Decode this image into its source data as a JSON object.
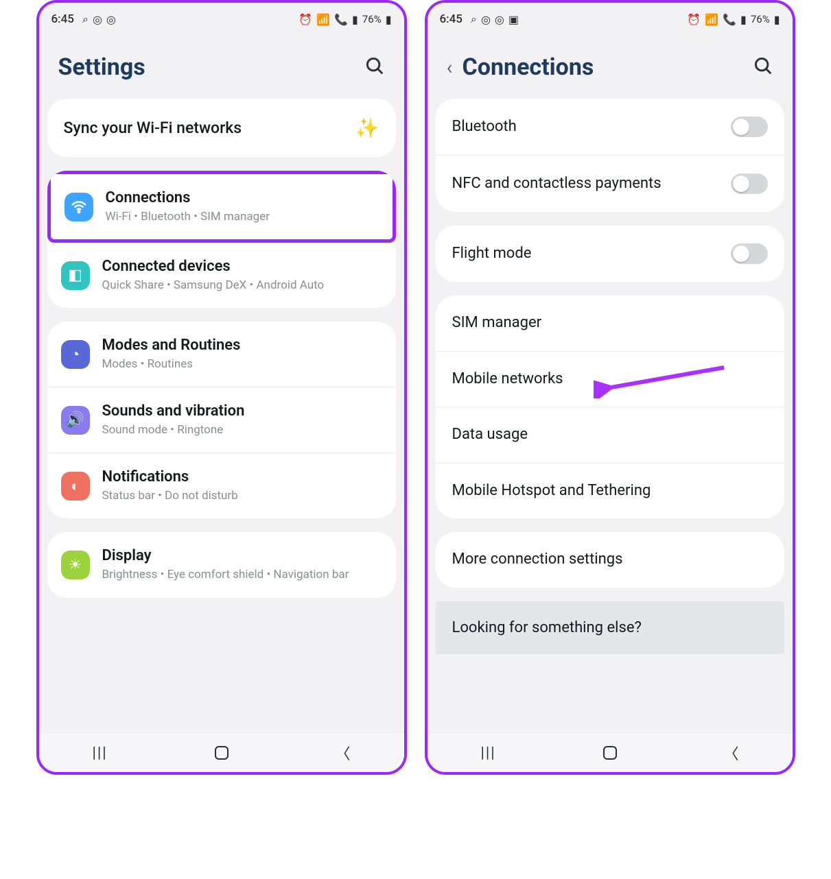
{
  "status": {
    "time": "6:45",
    "battery_pct": "76%"
  },
  "left": {
    "title": "Settings",
    "sync_label": "Sync your Wi-Fi networks",
    "items": [
      {
        "title": "Connections",
        "sub": "Wi-Fi  •  Bluetooth  •  SIM manager"
      },
      {
        "title": "Connected devices",
        "sub": "Quick Share  •  Samsung DeX  •  Android Auto"
      },
      {
        "title": "Modes and Routines",
        "sub": "Modes  •  Routines"
      },
      {
        "title": "Sounds and vibration",
        "sub": "Sound mode  •  Ringtone"
      },
      {
        "title": "Notifications",
        "sub": "Status bar  •  Do not disturb"
      },
      {
        "title": "Display",
        "sub": "Brightness  •  Eye comfort shield  •  Navigation bar"
      }
    ]
  },
  "right": {
    "title": "Connections",
    "rows": {
      "bluetooth": "Bluetooth",
      "nfc": "NFC and contactless payments",
      "flight": "Flight mode",
      "sim": "SIM manager",
      "mobile_net": "Mobile networks",
      "data_usage": "Data usage",
      "hotspot": "Mobile Hotspot and Tethering",
      "more": "More connection settings",
      "prompt": "Looking for something else?"
    }
  }
}
